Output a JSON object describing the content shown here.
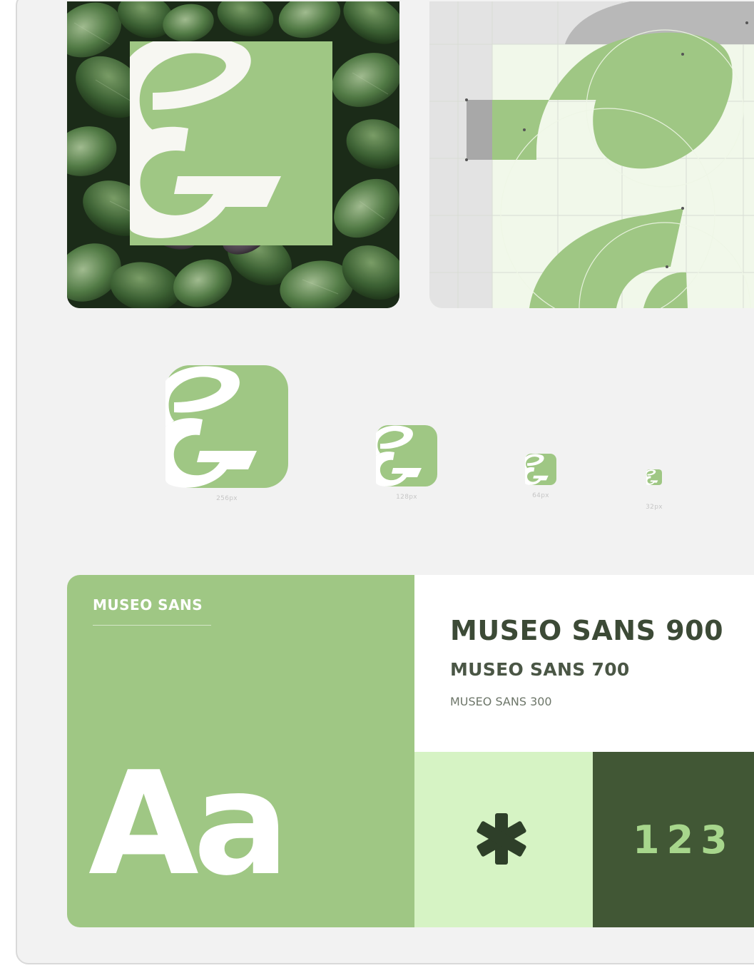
{
  "brand": {
    "colors": {
      "primary_green": "#9fc784",
      "light_green": "#d6f3c4",
      "dark_green": "#415735",
      "number_green": "#a7d68c",
      "white": "#ffffff"
    }
  },
  "icon_sizes": [
    {
      "caption": "256px"
    },
    {
      "caption": "128px"
    },
    {
      "caption": "64px"
    },
    {
      "caption": "32px"
    }
  ],
  "typography": {
    "family_label": "MUSEO SANS",
    "specimen": "Aa",
    "weights": {
      "w900": "MUSEO SANS 900",
      "w700": "MUSEO SANS 700",
      "w300": "MUSEO SANS 300"
    },
    "glyph_icon": "asterisk-icon",
    "numerals": "123"
  }
}
